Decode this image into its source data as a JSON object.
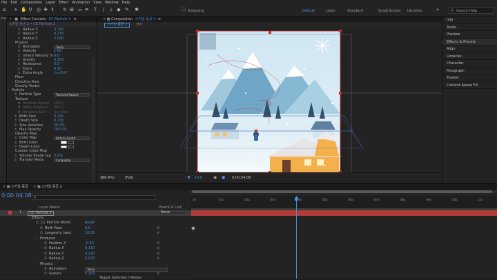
{
  "menu": [
    "File",
    "Edit",
    "Composition",
    "Layer",
    "Effect",
    "Animation",
    "View",
    "Window",
    "Help"
  ],
  "toolbar": {
    "snapping": "Snapping",
    "workspaces": [
      "Default",
      "Learn",
      "Standard",
      "Small Screen",
      "Libraries"
    ],
    "search_placeholder": "Search Help"
  },
  "left_strip": {
    "label": "Projec"
  },
  "effect_controls": {
    "tab_label": "Effect Controls",
    "layer_tab": "CC Particle 2",
    "title": "스카일 동궁 2 • CC Particle 2",
    "rows": [
      {
        "label": "Radius X",
        "value": "0.310",
        "indent": 2,
        "kind": "val",
        "dim": false
      },
      {
        "label": "Radius Y",
        "value": "0.230",
        "indent": 2,
        "kind": "val",
        "dim": false
      },
      {
        "label": "Radius Z",
        "value": "2.000",
        "indent": 2,
        "kind": "val",
        "dim": false
      },
      {
        "label": "Physics",
        "value": "",
        "indent": 1,
        "kind": "group",
        "dim": false
      },
      {
        "label": "Animation",
        "value": "Twirly",
        "indent": 2,
        "kind": "dd",
        "dim": false
      },
      {
        "label": "Velocity",
        "value": "1.00",
        "indent": 2,
        "kind": "val",
        "dim": false
      },
      {
        "label": "Inherit Velocity %",
        "value": "0.0",
        "indent": 2,
        "kind": "val",
        "dim": false
      },
      {
        "label": "Gravity",
        "value": "0.200",
        "indent": 2,
        "kind": "val",
        "dim": false
      },
      {
        "label": "Resistance",
        "value": "0.0",
        "indent": 2,
        "kind": "val",
        "dim": false
      },
      {
        "label": "Extra",
        "value": "0.50",
        "indent": 2,
        "kind": "val",
        "dim": false
      },
      {
        "label": "Extra Angle",
        "value": "1x+0.0°",
        "indent": 2,
        "kind": "val",
        "dim": false
      },
      {
        "label": "Floor",
        "value": "",
        "indent": 1,
        "kind": "group",
        "dim": false
      },
      {
        "label": "Direction Axis",
        "value": "",
        "indent": 1,
        "kind": "group",
        "dim": false
      },
      {
        "label": "Gravity Vector",
        "value": "",
        "indent": 1,
        "kind": "group",
        "dim": false
      },
      {
        "label": "Particle",
        "value": "",
        "indent": 0,
        "kind": "group",
        "dim": false
      },
      {
        "label": "Particle Type",
        "value": "Textured Square",
        "indent": 1,
        "kind": "dd",
        "dim": false
      },
      {
        "label": "Texture",
        "value": "",
        "indent": 1,
        "kind": "group",
        "dim": false
      },
      {
        "label": "Rotation Speed",
        "value": "100.0",
        "indent": 2,
        "kind": "val",
        "dim": true
      },
      {
        "label": "Initial Rotation",
        "value": "360.0",
        "indent": 2,
        "kind": "val",
        "dim": true
      },
      {
        "label": "Rotation Axis",
        "value": "Any Axis",
        "indent": 2,
        "kind": "val",
        "dim": true
      },
      {
        "label": "Birth Size",
        "value": "0.230",
        "indent": 1,
        "kind": "val",
        "dim": false
      },
      {
        "label": "Death Size",
        "value": "0.230",
        "indent": 1,
        "kind": "val",
        "dim": false
      },
      {
        "label": "Size Variation",
        "value": "50.0%",
        "indent": 1,
        "kind": "val",
        "dim": false
      },
      {
        "label": "Max Opacity",
        "value": "100.0%",
        "indent": 1,
        "kind": "val",
        "dim": false
      },
      {
        "label": "Opacity Map",
        "value": "",
        "indent": 1,
        "kind": "group",
        "dim": false
      },
      {
        "label": "Color Map",
        "value": "Birth to Death",
        "indent": 1,
        "kind": "dd",
        "dim": false
      },
      {
        "label": "Birth Color",
        "value": "",
        "indent": 1,
        "kind": "swatch",
        "dim": false
      },
      {
        "label": "Death Color",
        "value": "",
        "indent": 1,
        "kind": "swatch",
        "dim": false
      },
      {
        "label": "Custom Color Map",
        "value": "",
        "indent": 1,
        "kind": "group",
        "dim": false
      },
      {
        "label": "Volume Shade (ap",
        "value": "0.0%",
        "indent": 1,
        "kind": "val",
        "dim": false
      },
      {
        "label": "Transfer Mode",
        "value": "Composite",
        "indent": 1,
        "kind": "dd",
        "dim": false
      }
    ]
  },
  "composition": {
    "tab_label": "Composition",
    "comp_name": "스카일 동궁 2",
    "sub_tabs": [
      "스카일 동궁 2",
      "전지"
    ],
    "footer": {
      "zoom": "(66.4%)",
      "quality": "(Full)",
      "exposure": "+0.0",
      "timecode": "0;00;04;08"
    }
  },
  "right_panels": [
    {
      "label": "Info",
      "selected": false
    },
    {
      "label": "Audio",
      "selected": false
    },
    {
      "label": "Preview",
      "selected": false
    },
    {
      "label": "Effects & Presets",
      "selected": true
    },
    {
      "label": "Align",
      "selected": false
    },
    {
      "label": "Libraries",
      "selected": false
    },
    {
      "label": "Character",
      "selected": false
    },
    {
      "label": "Paragraph",
      "selected": false
    },
    {
      "label": "Tracker",
      "selected": false
    },
    {
      "label": "Content-Aware Fill",
      "selected": false
    }
  ],
  "timeline": {
    "tabs": [
      "스카일 동궁",
      "스카일 동궁 2"
    ],
    "timecode": "0:00:04:08",
    "header": {
      "layer_name": "Layer Name",
      "parent": "Parent & Link"
    },
    "layer": {
      "index": "1",
      "name": "CC Particle 2",
      "parent": "None"
    },
    "ruler_ticks": [
      "0s",
      "01s",
      "02s",
      "03s",
      "04s",
      "05s",
      "06s",
      "07s",
      "08s",
      "09s",
      "10s",
      "11s"
    ],
    "current_time_fraction": 0.364,
    "rows": [
      {
        "label": "Effects",
        "value": "",
        "indent": 1,
        "kind": "group"
      },
      {
        "label": "CC Particle World",
        "value": "Reset",
        "indent": 2,
        "kind": "val"
      },
      {
        "label": "Birth Rate",
        "value": "0.0",
        "indent": 3,
        "kind": "val"
      },
      {
        "label": "Longevity (sec)",
        "value": "10.00",
        "indent": 3,
        "kind": "val"
      },
      {
        "label": "Producer",
        "value": "",
        "indent": 3,
        "kind": "group"
      },
      {
        "label": "Position X",
        "value": "-0.50",
        "indent": 4,
        "kind": "val"
      },
      {
        "label": "Radius X",
        "value": "0.310",
        "indent": 4,
        "kind": "val"
      },
      {
        "label": "Radius Y",
        "value": "0.230",
        "indent": 4,
        "kind": "val"
      },
      {
        "label": "Radius Z",
        "value": "2.000",
        "indent": 4,
        "kind": "val"
      },
      {
        "label": "Physics",
        "value": "",
        "indent": 3,
        "kind": "group"
      },
      {
        "label": "Animation",
        "value": "Twirly",
        "indent": 4,
        "kind": "dd"
      },
      {
        "label": "Gravity",
        "value": "0.200",
        "indent": 4,
        "kind": "val"
      }
    ],
    "toggle_label": "Toggle Switches / Modes"
  }
}
